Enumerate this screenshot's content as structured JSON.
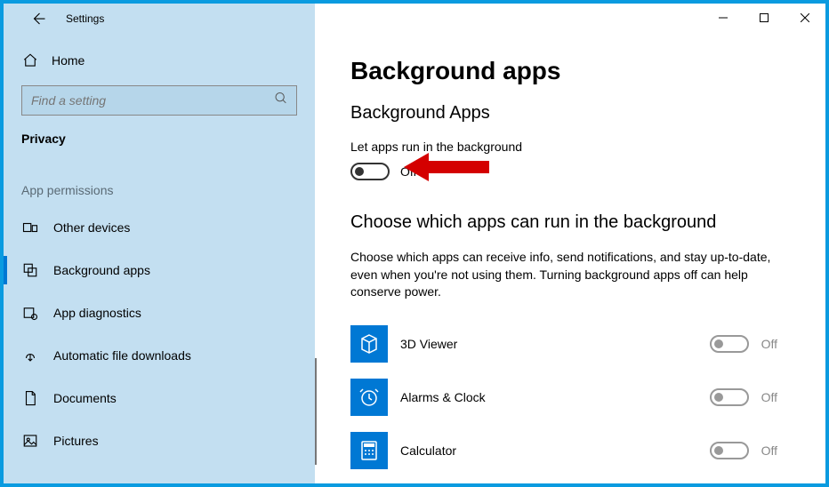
{
  "window": {
    "title": "Settings"
  },
  "sidebar": {
    "home": "Home",
    "search_placeholder": "Find a setting",
    "header": "Privacy",
    "group": "App permissions",
    "items": [
      {
        "icon": "other-devices-icon",
        "label": "Other devices"
      },
      {
        "icon": "background-apps-icon",
        "label": "Background apps"
      },
      {
        "icon": "app-diagnostics-icon",
        "label": "App diagnostics"
      },
      {
        "icon": "download-icon",
        "label": "Automatic file downloads"
      },
      {
        "icon": "document-icon",
        "label": "Documents"
      },
      {
        "icon": "picture-icon",
        "label": "Pictures"
      }
    ],
    "selected_index": 1
  },
  "main": {
    "title": "Background apps",
    "subtitle": "Background Apps",
    "toggle_label": "Let apps run in the background",
    "toggle_state": "Off",
    "section2": "Choose which apps can run in the background",
    "desc": "Choose which apps can receive info, send notifications, and stay up-to-date, even when you're not using them. Turning background apps off can help conserve power.",
    "apps": [
      {
        "name": "3D Viewer",
        "state": "Off"
      },
      {
        "name": "Alarms & Clock",
        "state": "Off"
      },
      {
        "name": "Calculator",
        "state": "Off"
      }
    ]
  }
}
